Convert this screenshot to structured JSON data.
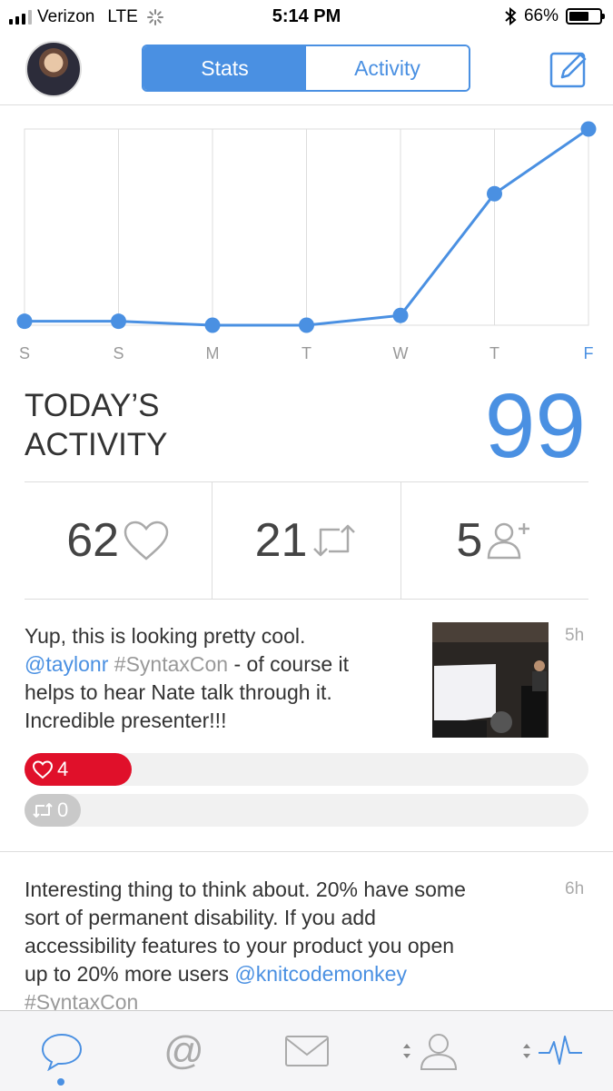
{
  "status_bar": {
    "carrier": "Verizon",
    "network": "LTE",
    "time": "5:14 PM",
    "battery": "66%",
    "battery_level": 0.66
  },
  "nav": {
    "tabs": [
      {
        "label": "Stats",
        "active": true
      },
      {
        "label": "Activity",
        "active": false
      }
    ]
  },
  "chart_data": {
    "type": "line",
    "categories": [
      "S",
      "S",
      "M",
      "T",
      "W",
      "T",
      "F"
    ],
    "values": [
      2,
      2,
      0,
      0,
      5,
      67,
      100
    ],
    "ylim": [
      0,
      100
    ],
    "grid": true,
    "highlight_category_index": 6,
    "color": "#4a90e2"
  },
  "today": {
    "title_line1": "TODAY’S",
    "title_line2": "ACTIVITY",
    "total": "99"
  },
  "stats": [
    {
      "value": "62",
      "icon": "heart-icon"
    },
    {
      "value": "21",
      "icon": "retweet-icon"
    },
    {
      "value": "5",
      "icon": "add-follower-icon"
    }
  ],
  "tweets": [
    {
      "line1": "Yup, this is looking pretty cool.",
      "mention": "@taylonr",
      "hashtag": "#SyntaxCon",
      "line2_rest": " - of course it",
      "line3": "helps to hear Nate talk through it.",
      "line4": "Incredible presenter!!!",
      "age": "5h",
      "likes": "4",
      "likes_fraction": 0.19,
      "retweets": "0",
      "retweets_fraction": 0.1
    },
    {
      "line1": "Interesting thing to think about. 20% have some",
      "line2": "sort of permanent disability. If you add",
      "line3": "accessibility features to your product you open",
      "line4_text": "up to 20% more users ",
      "mention": "@knitcodemonkey",
      "hashtag": "#SyntaxCon",
      "age": "6h"
    }
  ],
  "tab_bar": {
    "items": [
      "timeline-icon",
      "mentions-icon",
      "messages-icon",
      "profile-icon",
      "activity-icon"
    ],
    "active_index": 0
  },
  "colors": {
    "accent": "#4a90e2",
    "like": "#e0102a",
    "retweet_badge": "#c9c9c9"
  }
}
